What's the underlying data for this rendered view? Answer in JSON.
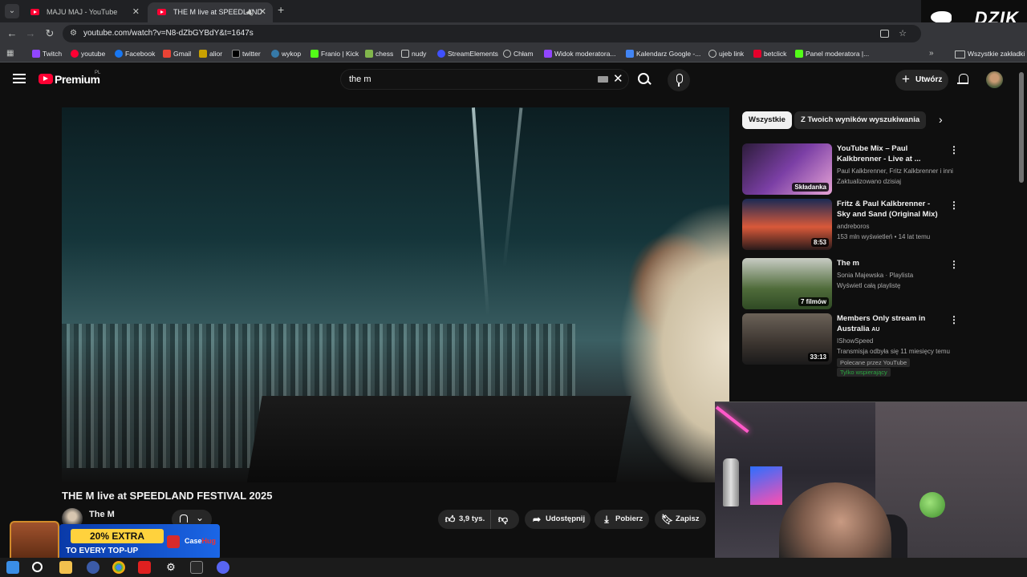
{
  "browser": {
    "tabs": [
      {
        "title": "MAJU MAJ - YouTube",
        "active": false
      },
      {
        "title": "THE M live at SPEEDLAND",
        "active": true
      }
    ],
    "url": "youtube.com/watch?v=N8-dZbGYBdY&t=1647s",
    "bookmarks": [
      "Twitch",
      "youtube",
      "Facebook",
      "Gmail",
      "alior",
      "twitter",
      "wykop",
      "Franio | Kick",
      "chess",
      "nudy",
      "StreamElements",
      "Chłam",
      "Widok moderatora...",
      "Kalendarz Google -...",
      "ujeb link",
      "betclick",
      "Panel moderatora |..."
    ],
    "all_bookmarks_label": "Wszystkie zakładki"
  },
  "overlay": {
    "brand_logo": "DZIK",
    "promo_big": "20% EXTRA",
    "promo_small": "TO EVERY TOP-UP",
    "promo_brand_a": "Case",
    "promo_brand_b": "Hug"
  },
  "header": {
    "logo_text": "Premium",
    "logo_region": "PL",
    "search_value": "the m",
    "create_label": "Utwórz"
  },
  "video": {
    "title": "THE M live at SPEEDLAND FESTIVAL 2025",
    "channel": "The M",
    "likes": "3,9 tys.",
    "share_label": "Udostępnij",
    "download_label": "Pobierz",
    "save_label": "Zapisz"
  },
  "sidebar": {
    "chips": [
      "Wszystkie",
      "Z Twoich wyników wyszukiwania"
    ],
    "items": [
      {
        "title": "YouTube Mix – Paul Kalkbrenner - Live at ...",
        "meta1": "Paul Kalkbrenner, Fritz Kalkbrenner i inni",
        "meta2": "Zaktualizowano dzisiaj",
        "badge": "Składanka"
      },
      {
        "title": "Fritz & Paul Kalkbrenner - Sky and Sand (Original Mix)",
        "meta1": "andreboros",
        "meta2": "153 mln wyświetleń • 14 lat temu",
        "badge": "8:53"
      },
      {
        "title": "The m",
        "meta1": "Sonia Majewska · Playlista",
        "meta2": "Wyświetl całą playlistę",
        "badge": "7 filmów"
      },
      {
        "title": "Members Only stream in Australia",
        "title_suffix": "AU",
        "meta1": "IShowSpeed",
        "meta2": "Transmisja odbyła się 11 miesięcy temu",
        "tag1": "Polecane przez YouTube",
        "tag2": "Tylko wspierający",
        "badge": "33:13"
      }
    ]
  }
}
